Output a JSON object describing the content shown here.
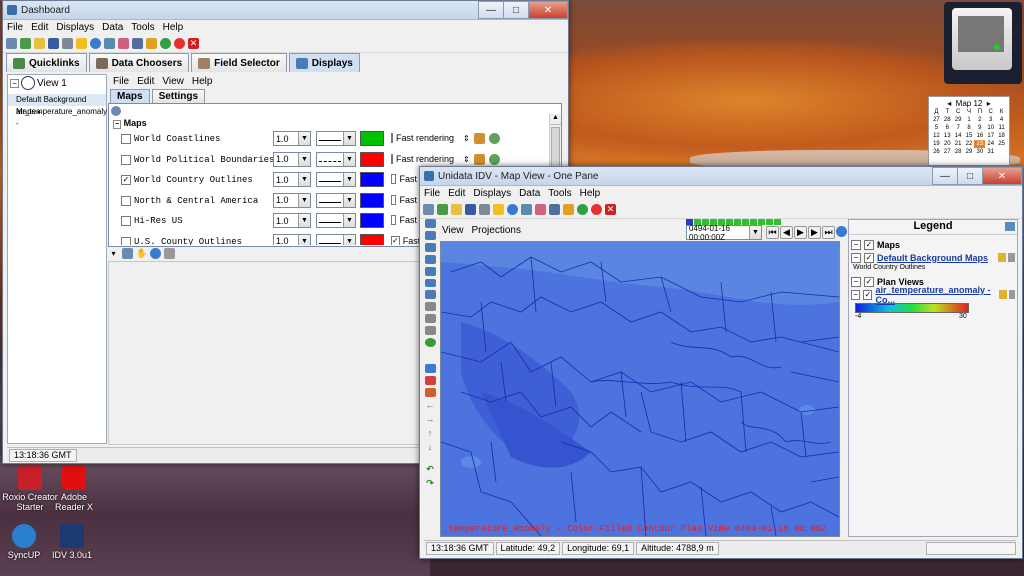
{
  "desktop": {
    "icons": [
      {
        "label_1": "Roxio Creator",
        "label_2": "Starter"
      },
      {
        "label_1": "Adobe",
        "label_2": "Reader X"
      },
      {
        "label_1": "SyncUP",
        "label_2": ""
      },
      {
        "label_1": "IDV 3.0u1",
        "label_2": ""
      }
    ],
    "calendar": {
      "title": "Map 12",
      "days_header": [
        "Д",
        "Т",
        "С",
        "Ч",
        "П",
        "С",
        "К"
      ],
      "today": "23"
    }
  },
  "dashboard": {
    "title": "Dashboard",
    "menu": [
      "File",
      "Edit",
      "Displays",
      "Data",
      "Tools",
      "Help"
    ],
    "tabs": [
      "Quicklinks",
      "Data Choosers",
      "Field Selector",
      "Displays"
    ],
    "view_label": "View 1",
    "tree_items": [
      "Default Background Maps",
      "air_temperature_anomaly -"
    ],
    "inner_menu": [
      "File",
      "Edit",
      "View",
      "Help"
    ],
    "inner_tabs": [
      "Maps",
      "Settings"
    ],
    "section_label": "Maps",
    "map_rows": [
      {
        "name": "World Coastlines",
        "checked": false,
        "width": "1.0",
        "color": "#00c000",
        "fast": "Fast rendering"
      },
      {
        "name": "World Political Boundaries",
        "checked": false,
        "width": "1.0",
        "color": "#ff0000",
        "fast": "Fast rendering"
      },
      {
        "name": "World Country Outlines",
        "checked": true,
        "width": "1.0",
        "color": "#0000ff",
        "fast": "Fast"
      },
      {
        "name": "North & Central America",
        "checked": false,
        "width": "1.0",
        "color": "#0000ff",
        "fast": "Fast"
      },
      {
        "name": "Hi-Res US",
        "checked": false,
        "width": "1.0",
        "color": "#0000ff",
        "fast": "Fast"
      },
      {
        "name": "U.S. County Outlines",
        "checked": false,
        "width": "1.0",
        "color": "#ff0000",
        "fast": "Fast"
      }
    ],
    "status_time": "13:18:36 GMT"
  },
  "mapview": {
    "title": "Unidata IDV - Map View - One Pane",
    "menu": [
      "File",
      "Edit",
      "Displays",
      "Data",
      "Tools",
      "Help"
    ],
    "view_menu": [
      "View",
      "Projections"
    ],
    "time_value": "0494-01-16 00:00:00Z",
    "overlay_label": "_temperature_anomaly - Color-Filled Contour Plan View 0494-01-16 00:00Z",
    "legend": {
      "title": "Legend",
      "maps_group": "Maps",
      "maps_item": "Default Background Maps",
      "maps_sub": "World Country Outlines",
      "plan_group": "Plan Views",
      "plan_item": "air_temperature_anomaly - Co...",
      "scale_min": "-4",
      "scale_max": "30"
    },
    "status": {
      "time": "13:18:36 GMT",
      "latitude": "Latitude: 49,2",
      "longitude": "Longitude: 69,1",
      "altitude": "Altitude: 4788,9 m"
    }
  }
}
